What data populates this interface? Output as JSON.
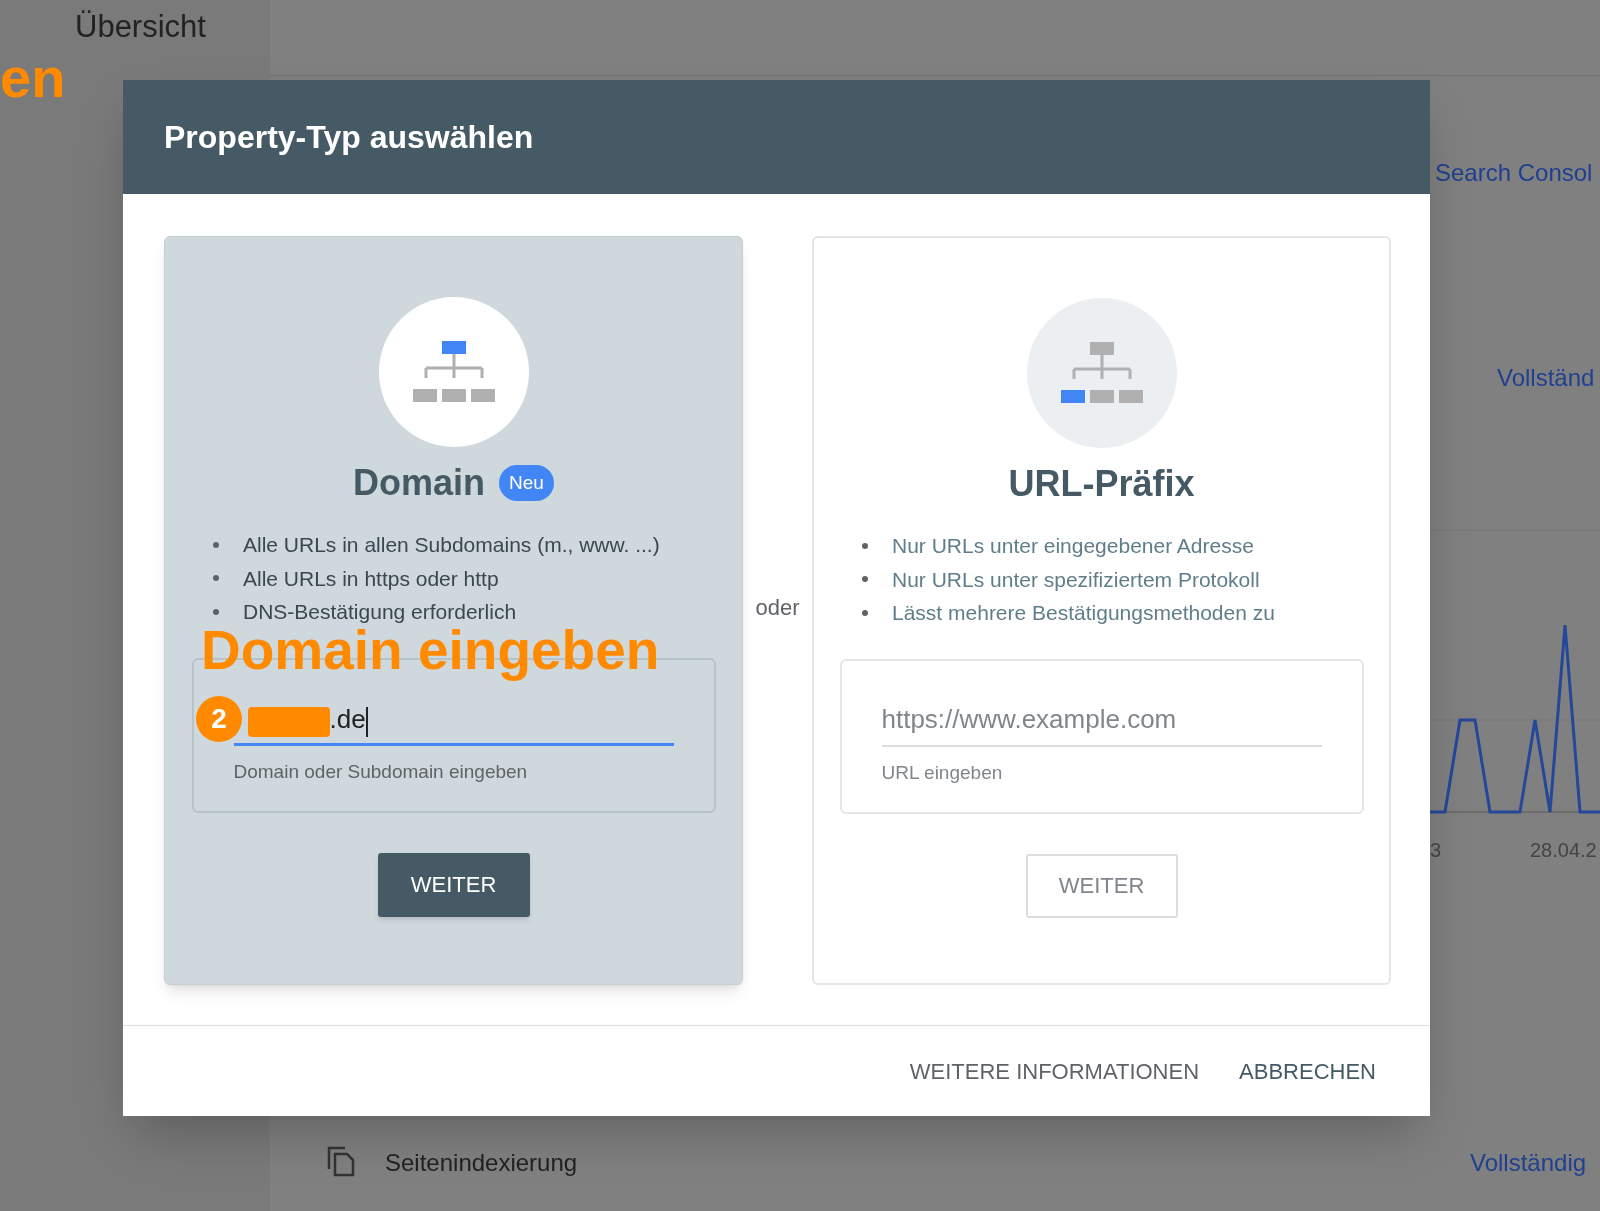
{
  "background": {
    "page_title": "Übersicht",
    "side_link": "Search Consol",
    "status_link": "Vollständ",
    "chart_tick_labels": [
      "3",
      "28.04.2"
    ],
    "bottom_row": {
      "label": "Seitenindexierung",
      "link": "Vollständig"
    }
  },
  "annotations": {
    "edge_text": "en",
    "heading": "Domain eingeben",
    "step": "2"
  },
  "dialog": {
    "title": "Property-Typ auswählen",
    "separator": "oder",
    "options": [
      {
        "kind": "domain",
        "selected": true,
        "title": "Domain",
        "badge": "Neu",
        "bullets": [
          "Alle URLs in allen Subdomains (m., www. ...)",
          "Alle URLs in https oder http",
          "DNS-Bestätigung erforderlich"
        ],
        "value_end": ".de",
        "redacted": true,
        "helper": "Domain oder Subdomain eingeben",
        "button": "WEITER"
      },
      {
        "kind": "url",
        "selected": false,
        "title": "URL-Präfix",
        "bullets": [
          "Nur URLs unter eingegebener Adresse",
          "Nur URLs unter spezifiziertem Protokoll",
          "Lässt mehrere Bestätigungsmethoden zu"
        ],
        "placeholder": "https://www.example.com",
        "helper": "URL eingeben",
        "button": "WEITER"
      }
    ],
    "footer_buttons": [
      "WEITERE INFORMATIONEN",
      "ABBRECHEN"
    ]
  }
}
